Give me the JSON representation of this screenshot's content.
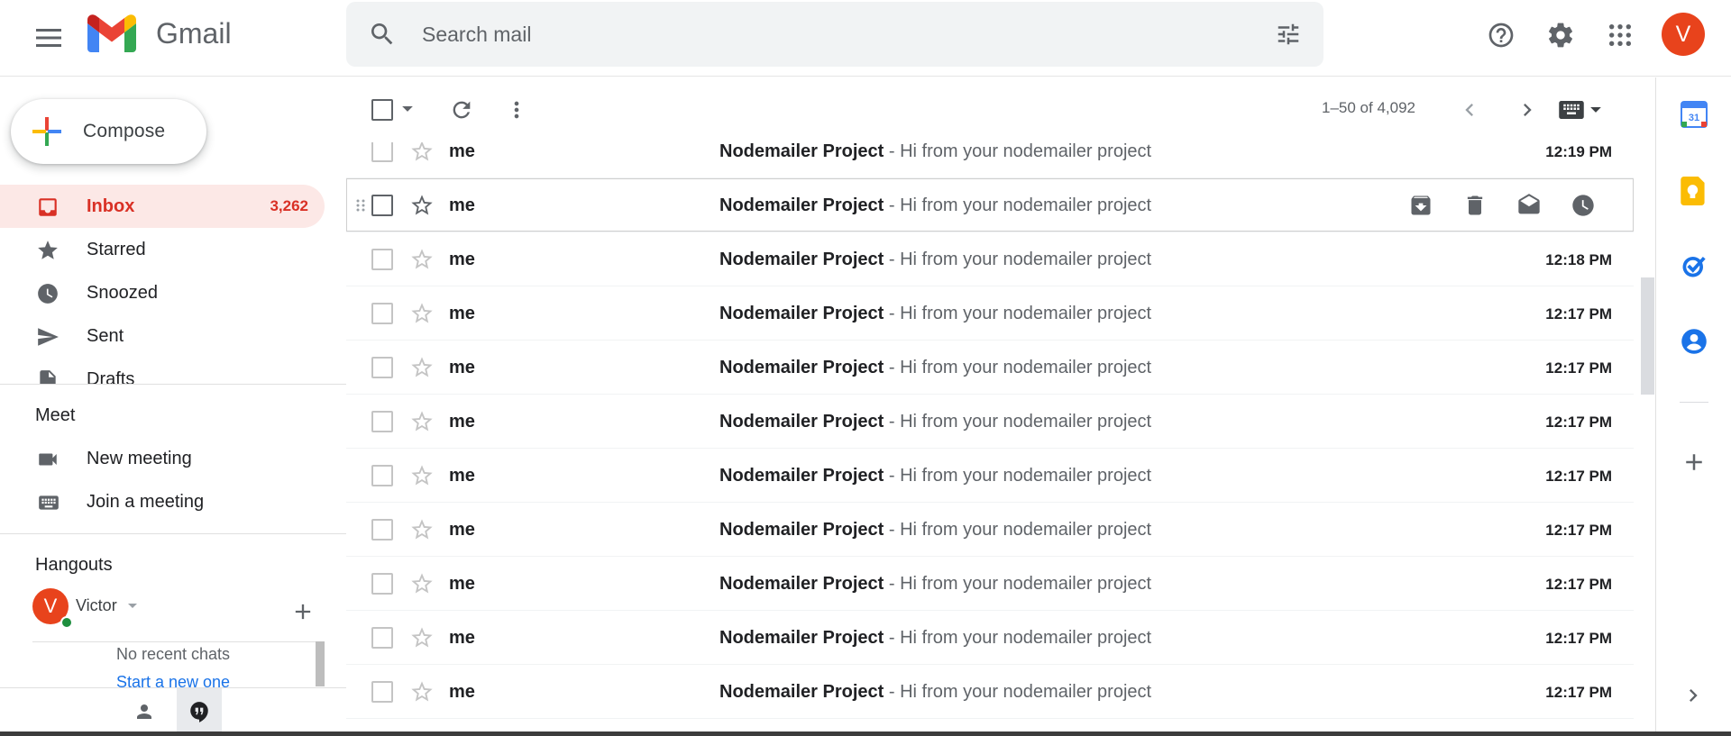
{
  "app": {
    "name": "Gmail",
    "avatar_letter": "V"
  },
  "search": {
    "placeholder": "Search mail"
  },
  "compose": {
    "label": "Compose"
  },
  "nav": [
    {
      "label": "Inbox",
      "count": "3,262",
      "icon": "inbox-icon",
      "active": true
    },
    {
      "label": "Starred",
      "count": "",
      "icon": "star-icon"
    },
    {
      "label": "Snoozed",
      "count": "",
      "icon": "clock-icon"
    },
    {
      "label": "Sent",
      "count": "",
      "icon": "send-icon"
    },
    {
      "label": "Drafts",
      "count": "",
      "icon": "draft-icon"
    }
  ],
  "meet": {
    "title": "Meet",
    "new_meeting": "New meeting",
    "join_meeting": "Join a meeting"
  },
  "hangouts": {
    "title": "Hangouts",
    "user": "Victor",
    "user_initial": "V",
    "no_chats": "No recent chats",
    "start_new": "Start a new one"
  },
  "toolbar": {
    "range": "1–50 of 4,092"
  },
  "emails": [
    {
      "sender": "me",
      "subject": "Nodemailer Project",
      "snippet": "Hi from your nodemailer project",
      "time": "12:19 PM"
    },
    {
      "sender": "me",
      "subject": "Nodemailer Project",
      "snippet": "Hi from your nodemailer project",
      "time": "",
      "hover": true
    },
    {
      "sender": "me",
      "subject": "Nodemailer Project",
      "snippet": "Hi from your nodemailer project",
      "time": "12:18 PM"
    },
    {
      "sender": "me",
      "subject": "Nodemailer Project",
      "snippet": "Hi from your nodemailer project",
      "time": "12:17 PM"
    },
    {
      "sender": "me",
      "subject": "Nodemailer Project",
      "snippet": "Hi from your nodemailer project",
      "time": "12:17 PM"
    },
    {
      "sender": "me",
      "subject": "Nodemailer Project",
      "snippet": "Hi from your nodemailer project",
      "time": "12:17 PM"
    },
    {
      "sender": "me",
      "subject": "Nodemailer Project",
      "snippet": "Hi from your nodemailer project",
      "time": "12:17 PM"
    },
    {
      "sender": "me",
      "subject": "Nodemailer Project",
      "snippet": "Hi from your nodemailer project",
      "time": "12:17 PM"
    },
    {
      "sender": "me",
      "subject": "Nodemailer Project",
      "snippet": "Hi from your nodemailer project",
      "time": "12:17 PM"
    },
    {
      "sender": "me",
      "subject": "Nodemailer Project",
      "snippet": "Hi from your nodemailer project",
      "time": "12:17 PM"
    },
    {
      "sender": "me",
      "subject": "Nodemailer Project",
      "snippet": "Hi from your nodemailer project",
      "time": "12:17 PM"
    }
  ],
  "row_actions": [
    "archive-icon",
    "delete-icon",
    "mark-read-icon",
    "snooze-icon"
  ],
  "right_panel": [
    "calendar-icon",
    "keep-icon",
    "tasks-icon",
    "contacts-icon",
    "add-icon",
    "expand-icon"
  ],
  "calendar_day": "31",
  "colors": {
    "accent_red": "#d93025",
    "inbox_bg": "#fce8e6",
    "avatar": "#e8431c",
    "link_blue": "#1a73e8"
  }
}
